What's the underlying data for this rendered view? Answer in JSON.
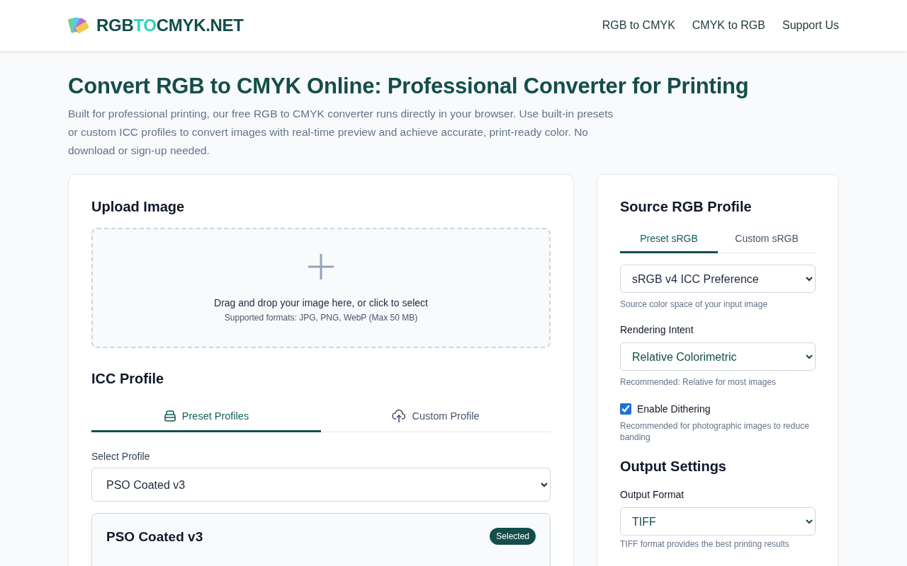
{
  "header": {
    "logo_parts": [
      {
        "text": "RGB",
        "accent": false
      },
      {
        "text": "TO",
        "accent": true
      },
      {
        "text": "CMYK.NET",
        "accent": false
      }
    ],
    "nav": [
      "RGB to CMYK",
      "CMYK to RGB",
      "Support Us"
    ]
  },
  "hero": {
    "title": "Convert RGB to CMYK Online: Professional Converter for Printing",
    "description": "Built for professional printing, our free RGB to CMYK converter runs directly in your browser. Use built-in presets or custom ICC profiles to convert images with real-time preview and achieve accurate, print-ready color. No download or sign-up needed."
  },
  "upload": {
    "heading": "Upload Image",
    "prompt": "Drag and drop your image here, or click to select",
    "formats": "Supported formats: JPG, PNG, WebP (Max 50 MB)"
  },
  "icc": {
    "heading": "ICC Profile",
    "tabs": [
      {
        "label": "Preset Profiles",
        "selected": true
      },
      {
        "label": "Custom Profile",
        "selected": false
      }
    ],
    "select_label": "Select Profile",
    "select_value": "PSO Coated v3",
    "profile_card": {
      "name": "PSO Coated v3",
      "badge": "Selected"
    }
  },
  "source": {
    "heading": "Source RGB Profile",
    "tabs": [
      {
        "label": "Preset sRGB",
        "selected": true
      },
      {
        "label": "Custom sRGB",
        "selected": false
      }
    ],
    "select_value": "sRGB v4 ICC Preference",
    "select_hint": "Source color space of your input image",
    "intent_label": "Rendering Intent",
    "intent_value": "Relative Colorimetric",
    "intent_hint": "Recommended: Relative for most images",
    "dither_label": "Enable Dithering",
    "dither_checked": true,
    "dither_hint": "Recommended for photographic images to reduce banding"
  },
  "output": {
    "heading": "Output Settings",
    "format_label": "Output Format",
    "format_value": "TIFF",
    "format_hint": "TIFF format provides the best printing results"
  }
}
